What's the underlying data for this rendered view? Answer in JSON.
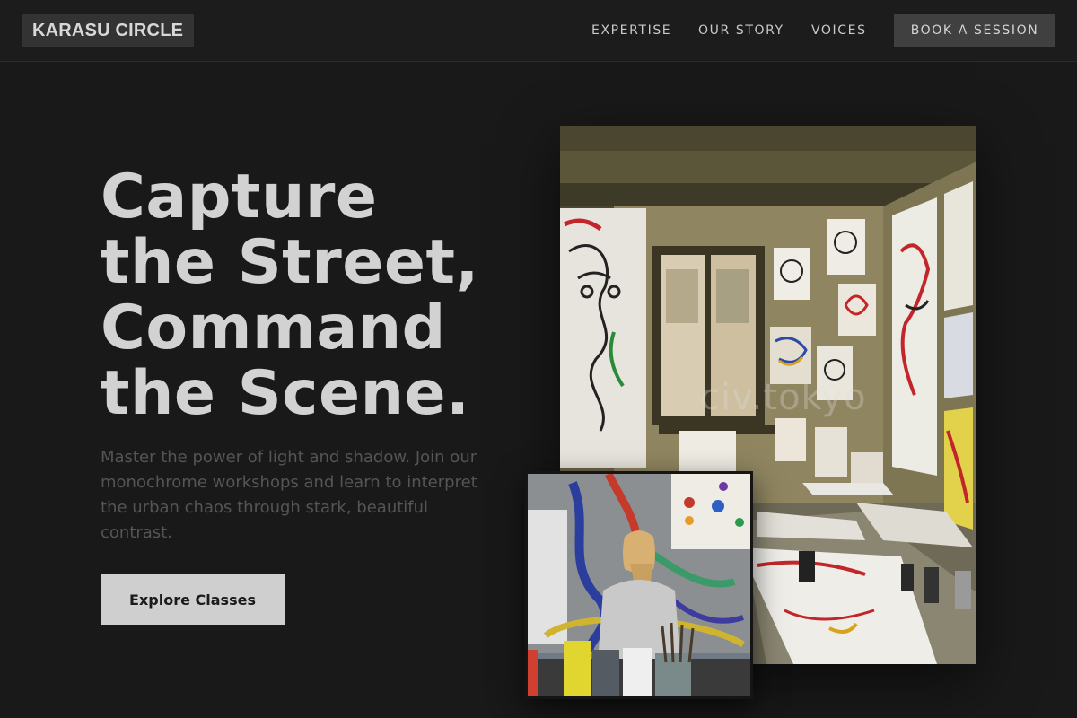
{
  "header": {
    "logo": "KARASU CIRCLE",
    "nav": [
      "EXPERTISE",
      "OUR STORY",
      "VOICES"
    ],
    "book_button": "BOOK A SESSION"
  },
  "hero": {
    "title_lines": [
      "Capture",
      "the Street,",
      "Command",
      "the Scene."
    ],
    "description": "Master the power of light and shadow. Join our monochrome workshops and learn to interpret the urban chaos through stark, beautiful contrast.",
    "cta": "Explore Classes"
  },
  "images": {
    "main_watermark": "civ.tokyo"
  },
  "colors": {
    "background": "#191919",
    "title": "#d2d2d2",
    "button": "#cfcfcf"
  }
}
